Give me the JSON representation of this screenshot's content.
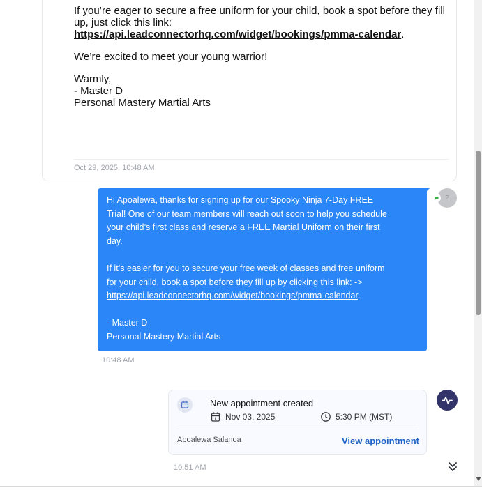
{
  "email": {
    "line1": "If you’re eager to secure a free uniform for your child, book a spot before they fill",
    "line2": "up, just click this link:",
    "link": "https://api.leadconnectorhq.com/widget/bookings/pmma-calendar",
    "link_suffix": ".",
    "excited": "We’re excited to meet your young warrior!",
    "sign1": "Warmly,",
    "sign2": "- Master D",
    "sign3": "Personal Mastery Martial Arts",
    "timestamp": "Oct 29, 2025, 10:48 AM"
  },
  "sms": {
    "l1": "Hi Apoalewa, thanks for signing up for our Spooky Ninja 7-Day FREE",
    "l2": "Trial! One of our team members will reach out soon to help you schedule",
    "l3": "your child’s first class and reserve a FREE Martial Uniform on their first",
    "l4": "day.",
    "l5": "If it’s easier for you to secure your free week of classes and free uniform",
    "l6": "for your child, book a spot before they fill up by clicking this link: ->",
    "link": "https://api.leadconnectorhq.com/widget/bookings/pmma-calendar",
    "link_suffix": ".",
    "l8": "- Master D",
    "l9": "Personal Mastery Martial Arts",
    "timestamp": "10:48 AM",
    "avatar_initial": "?",
    "bubble_color": "#2b86f7"
  },
  "appointment": {
    "title": "New appointment created",
    "date": "Nov 03, 2025",
    "time": "5:30 PM (MST)",
    "contact_name": "Apoalewa Salanoa",
    "view_label": "View appointment",
    "timestamp": "10:51 AM",
    "link_color": "#1e63c9"
  },
  "activity_avatar_color": "#32346a",
  "icons": [
    "calendar-icon",
    "date-icon",
    "clock-icon",
    "activity-icon",
    "sms-icon",
    "double-chevron-down-icon"
  ]
}
